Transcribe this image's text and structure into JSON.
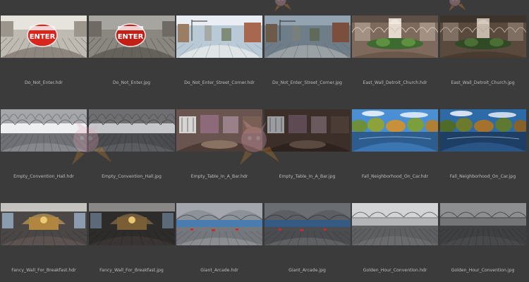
{
  "assets": [
    {
      "name": "Do_Not_Enter.hdr",
      "scene": "enter",
      "variant": "hdr"
    },
    {
      "name": "Do_Not_Enter.jpg",
      "scene": "enter",
      "variant": "jpg"
    },
    {
      "name": "Do_Not_Enter_Street_Corner.hdr",
      "scene": "street",
      "variant": "hdr"
    },
    {
      "name": "Do_Not_Enter_Street_Corner.jpg",
      "scene": "street",
      "variant": "jpg"
    },
    {
      "name": "East_Wall_Detroit_Church.hdr",
      "scene": "church",
      "variant": "hdr"
    },
    {
      "name": "East_Wall_Detroit_Church.jpg",
      "scene": "church",
      "variant": "jpg"
    },
    {
      "name": "Empty_Convention_Hall.hdr",
      "scene": "hall",
      "variant": "hdr"
    },
    {
      "name": "Empty_Convention_Hall.jpg",
      "scene": "hall",
      "variant": "jpg"
    },
    {
      "name": "Empty_Table_In_A_Bar.hdr",
      "scene": "bar",
      "variant": "hdr"
    },
    {
      "name": "Empty_Table_In_A_Bar.jpg",
      "scene": "bar",
      "variant": "jpg"
    },
    {
      "name": "Fall_Neighborhood_On_Car.hdr",
      "scene": "fall",
      "variant": "hdr"
    },
    {
      "name": "Fall_Neighborhood_On_Car.jpg",
      "scene": "fall",
      "variant": "jpg"
    },
    {
      "name": "Fancy_Wall_For_Breakfast.hdr",
      "scene": "fancy",
      "variant": "hdr"
    },
    {
      "name": "Fancy_Wall_For_Breakfast.jpg",
      "scene": "fancy",
      "variant": "jpg"
    },
    {
      "name": "Giant_Arcade.hdr",
      "scene": "arcade",
      "variant": "hdr"
    },
    {
      "name": "Giant_Arcade.jpg",
      "scene": "arcade",
      "variant": "jpg"
    },
    {
      "name": "Golden_Hour_Convention.hdr",
      "scene": "golden",
      "variant": "hdr"
    },
    {
      "name": "Golden_Hour_Convention.jpg",
      "scene": "golden",
      "variant": "jpg"
    }
  ],
  "sign_text": "ENTER",
  "colors": {
    "background": "#3b3b3b",
    "label": "#bdbdbd",
    "sign_red": "#d8261c",
    "sky_blue": "#3f87d6",
    "watermark_pink": "#e9a3b8",
    "watermark_orange": "#d98c2b"
  }
}
